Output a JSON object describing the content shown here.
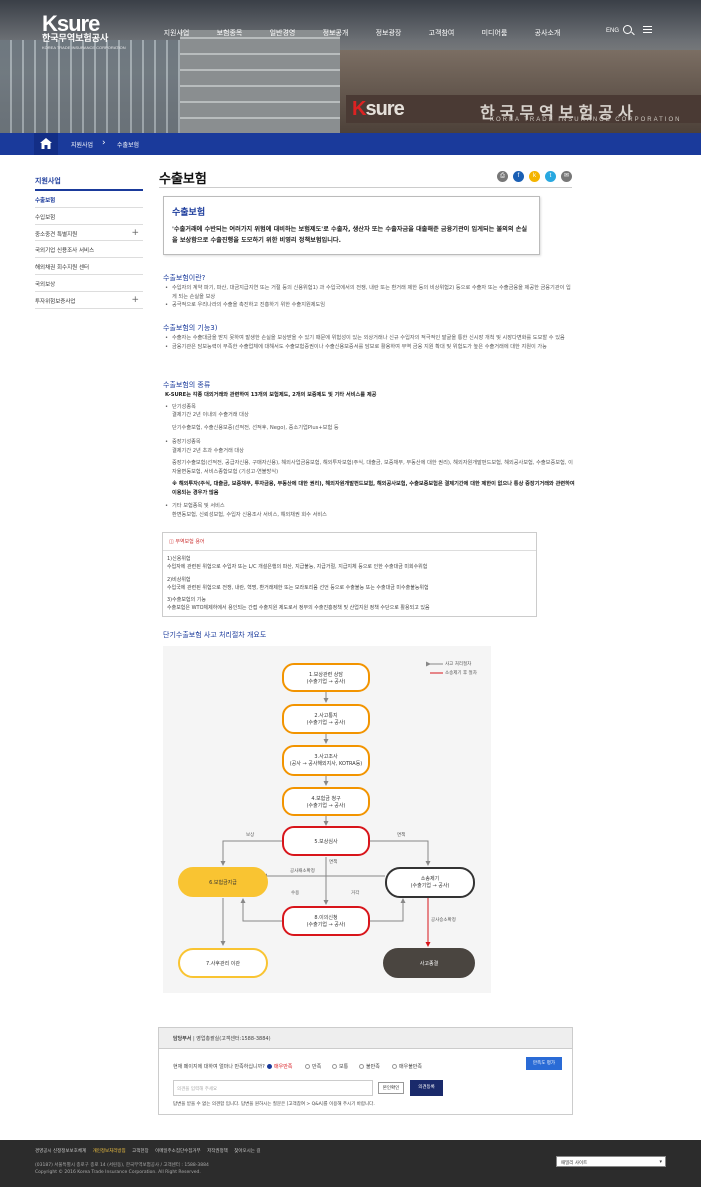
{
  "header": {
    "logo_main": "Ksure",
    "logo_kr": "한국무역보험공사",
    "logo_en": "KOREA TRADE INSURANCE CORPORATION",
    "nav": [
      "지원사업",
      "보험종목",
      "일반경영",
      "정보공개",
      "정보광장",
      "고객참여",
      "미디어룸",
      "공사소개"
    ],
    "eng": "ENG"
  },
  "hero": {
    "sign_logo": "Ksure",
    "sign_kr": "한국무역보험공사",
    "sign_en": "KOREA TRADE INSURANCE CORPORATION"
  },
  "breadcrumb": {
    "level1": "지원사업",
    "level2": "수출보험"
  },
  "sidebar": {
    "title": "지원사업",
    "items": [
      {
        "label": "수출보험"
      },
      {
        "label": "수입보험"
      },
      {
        "label": "중소중견 특별지원"
      },
      {
        "label": "국외기업 신용조사 서비스"
      },
      {
        "label": "해외채권 회수지원 센터"
      },
      {
        "label": "국외보상"
      },
      {
        "label": "투자위험보증사업"
      }
    ]
  },
  "page": {
    "title": "수출보험"
  },
  "share": {
    "colors": [
      "#777777",
      "#1a5fb4",
      "#f4b400",
      "#28a8e0",
      "#777777"
    ],
    "icons": [
      "print-icon",
      "facebook-icon",
      "kakao-icon",
      "twitter-icon",
      "mail-icon"
    ]
  },
  "summary": {
    "title": "수출보험",
    "body": "'수출거래에 수반되는 여러가지 위험에 대비하는 보험제도'로 수출자, 생산자 또는 수출자금을 대출해준 금융기관이 입게되는 불의의 손실을 보상함으로 수출진행을 도모하기 위한 비영리 정책보험입니다."
  },
  "what": {
    "title": "수출보험이란?",
    "b1": "수입자의 계약 파기, 파산, 대금지급지연 또는 거절 등의 신용위험1) 과 수입국에서의 전쟁, 내란 또는 환거래 제한 등의 비상위험2) 등으로 수출자 또는 수출금융을 제공한 금융기관이 입게 되는 손실을 보상",
    "b2": "공극적으로 우리나라의 수출을 촉진하고 진흥하기 위한 수출지원제도임"
  },
  "func": {
    "title": "수출보험의 기능3)",
    "b1": "수출자는 수출대금을 받지 못하여 발생한 손실을 보상받을 수 있기 때문에 위험성이 있는 외상거래나 신규 수입자의 적극적인 발굴을 통한 신시장 개척 및 시장다변화를 도모할 수 있음",
    "b2": "금융기관은 담보능력이 부족한 수출업체에 대해서도 수출보험증권이나 수출신용보증서를 담보로 활용하여 무역 금융 지원 확대 및 위험도가 높은 수출거래에 대한 지원이 가능"
  },
  "kinds": {
    "title": "수출보험의 종류",
    "intro": "K-SURE는 각종 대외거래와 관련하여 13개의 보험제도, 2개의 보증제도 및 기타 서비스를 제공",
    "short_h": "단기성종목",
    "short_d": "결제기간 2년 이내의 수출거래 대상",
    "short_l": "단기수출보험, 수출신용보증(선적전, 선적후, Nego), 중소기업Plus+보험 등",
    "mid_h": "중장기성종목",
    "mid_d": "결제기간 2년 초과 수출거래 대상",
    "mid_l": "중장기수출보험(선적전, 공급자신용, 구매자신용), 해외사업금융보험, 해외투자보험(주식, 대출금, 보증채무, 부동산에 대한 권리), 해외자원개발펀드보험, 해외공사보험, 수출보증보험, 이자율변동보험, 서비스종합보험 (기성고·연불방식)",
    "note": "※ 해외투자(주식, 대출금, 보증채무, 투자금융, 부동산에 대한 권리), 해외자원개발펀드보험, 해외공사보험, 수출보증보험은 결제기간에 대한 제한이 없으나 통상 중장기거래와 관련하여 이용되는 경우가 많음",
    "etc_h": "기타 보험종목 및 서비스",
    "etc_l": "환변동보험, 신뢰성보험, 수입자 신용조사 서비스, 해외채권 회수 서비스"
  },
  "terms": {
    "title": "무역보험 용어",
    "t1_h": "1)신용위험",
    "t1_d": "수입자에 관련된 위험으로 수입자 또는 L/C 개설은행의 파산, 지급불능, 지급거절, 지급지체 등으로 인한 수출대금 미회수위험",
    "t2_h": "2)비상위험",
    "t2_d": "수입국에 관련된 위험으로 전쟁, 내란, 혁명, 환거래제한 또는 모라토리움 선언 등으로 수출불능 또는 수출대금 미수출불능위험",
    "t3_h": "3)수출보험의 기능",
    "t3_d": "수출보험은 WTO체제하에서 용인되는 간접 수출지원 제도로서 정부의 수출진흥정책 및 산업지원 정책 수단으로 활용되고 있음"
  },
  "flow": {
    "title": "단기수출보험 사고 처리절차 개요도",
    "legend1": "사고 처리절차",
    "legend2": "소송제기 후 절차",
    "n1a": "1.보상관련 상담",
    "n1b": "(수출기업 → 공사)",
    "n2a": "2.사고통지",
    "n2b": "(수출기업 → 공사)",
    "n3a": "3.사고조사",
    "n3b": "(공사 → 공사해외지사, KOTRA등)",
    "n4a": "4.보험금 청구",
    "n4b": "(수출기업 → 공사)",
    "n5": "5.보상심사",
    "n6": "6.보험금지급",
    "n7": "7.사후관리 이관",
    "n8a": "8.이의신청",
    "n8b": "(수출기업 → 공사)",
    "nsa": "소송제기",
    "nsb": "(수출기업 → 공사)",
    "nend": "사고종결",
    "l_pay": "보상",
    "l_exempt": "면책",
    "l_exempt2": "면책",
    "l_confirm": "공사패소확정",
    "l_accept": "수용",
    "l_reject": "거각",
    "l_win": "공사승소확정"
  },
  "survey": {
    "dept": "담당부서",
    "dept_val": "영업총괄실(고객센터:1588-3884)",
    "question": "현재 페이지에 대하여 얼마나 만족하십니까?",
    "options": [
      "매우만족",
      "만족",
      "보통",
      "불만족",
      "매우불만족"
    ],
    "submit_opt": "만족도 평가",
    "placeholder": "의견을 입력해 주세요",
    "captcha": "본인확인",
    "send": "의견등록",
    "notice": "답변을 받을 수 없는 의견함 입니다. 답변을 원하시는 질문은 [고객참여 > Q&A]를 이용해 주시기 바랍니다."
  },
  "footer": {
    "links": [
      "경영공시 신정정보보호체계",
      "개인정보처리방침",
      "고객헌장",
      "이메일주소집단수집거부",
      "저작권정책",
      "찾아오시는 길"
    ],
    "address": "(03187) 서울특별시 종로구 종로 14 (서린동), 한국무역보험공사 / 고객센터 : 1588-3884",
    "copy": "Copyright © 2016 Korea Trade Insurance Corporation. All Right Reserved.",
    "family": "패밀리 사이트"
  }
}
